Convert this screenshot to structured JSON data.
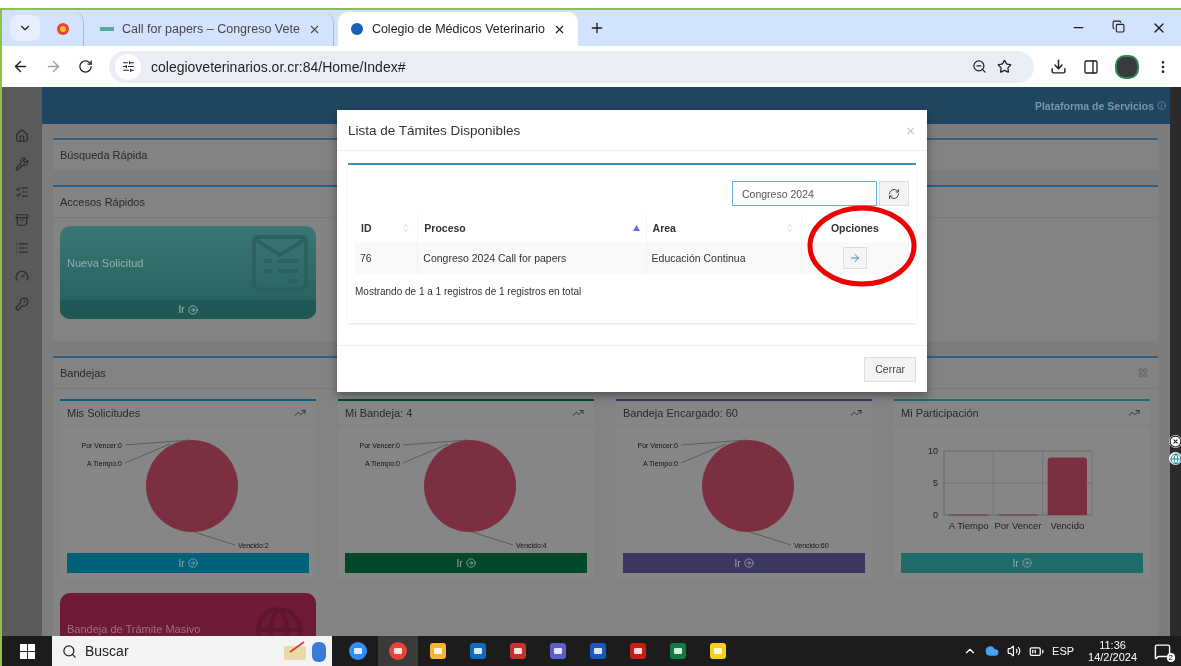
{
  "browser": {
    "tabs": [
      {
        "kind": "pinned",
        "selected": false
      },
      {
        "kind": "page",
        "title": "Call for papers – Congreso Vete",
        "selected": false
      },
      {
        "kind": "page",
        "title": "Colegio de Médicos Veterinario",
        "selected": true
      }
    ],
    "address": "colegioveterinarios.or.cr:84/Home/Index#"
  },
  "header": {
    "title": "Plataforma de Servicios"
  },
  "quick_search": {
    "title": "Búsqueda Rápida"
  },
  "quick_access": {
    "title": "Accesos Rápidos",
    "tiles": [
      {
        "label": "Nueva Solicitud",
        "link": "Ir"
      }
    ]
  },
  "trays": {
    "title": "Bandejas",
    "cards": [
      {
        "title": "Mis Solicitudes",
        "color": "#00627a",
        "link": "Ir",
        "chart_data": {
          "type": "pie",
          "categories": [
            "Por Vencer:0",
            "A Tiempo:0",
            "Vencido:2"
          ],
          "values": [
            0,
            0,
            2
          ]
        }
      },
      {
        "title": "Mi Bandeja: 4",
        "color": "#004a2b",
        "link": "Ir",
        "chart_data": {
          "type": "pie",
          "categories": [
            "Por Vencer:0",
            "A Tiempo:0",
            "Vencido:4"
          ],
          "values": [
            0,
            0,
            4
          ]
        }
      },
      {
        "title": "Bandeja Encargado: 60",
        "color": "#3b3760",
        "link": "Ir",
        "chart_data": {
          "type": "pie",
          "categories": [
            "Por Vencer:0",
            "A Tiempo:0",
            "Vencido:60"
          ],
          "values": [
            0,
            0,
            60
          ]
        }
      },
      {
        "title": "Mi Participación",
        "color": "#1e6b67",
        "link": "Ir",
        "chart_data": {
          "type": "bar",
          "categories": [
            "A Tiempo",
            "Por Vencer",
            "Vencido"
          ],
          "series": [
            {
              "color": "#7d2f42",
              "values": [
                0,
                0,
                9
              ]
            }
          ],
          "ylim": [
            0,
            10
          ],
          "yticks": [
            0,
            5,
            10
          ]
        }
      }
    ],
    "mass_tile": {
      "label": "Bandeja de Trámite Masivo"
    }
  },
  "modal": {
    "title": "Lista de Támites Disponibles",
    "close": "×",
    "search": "Congreso 2024",
    "columns": [
      {
        "label": "ID",
        "sorted": false
      },
      {
        "label": "Proceso",
        "sorted": true
      },
      {
        "label": "Area",
        "sorted": false
      },
      {
        "label": "Opciones"
      }
    ],
    "rows": [
      {
        "cells": [
          "76",
          "Congreso 2024 Call for papers",
          "Educación Continua"
        ]
      }
    ],
    "info": "Mostrando de 1 a 1 registros de 1 registros en total",
    "close_button": "Cerrar"
  },
  "taskbar": {
    "search_placeholder": "Buscar",
    "language": "ESP",
    "time": "11:36",
    "date": "14/2/2024",
    "notifications": "2"
  }
}
